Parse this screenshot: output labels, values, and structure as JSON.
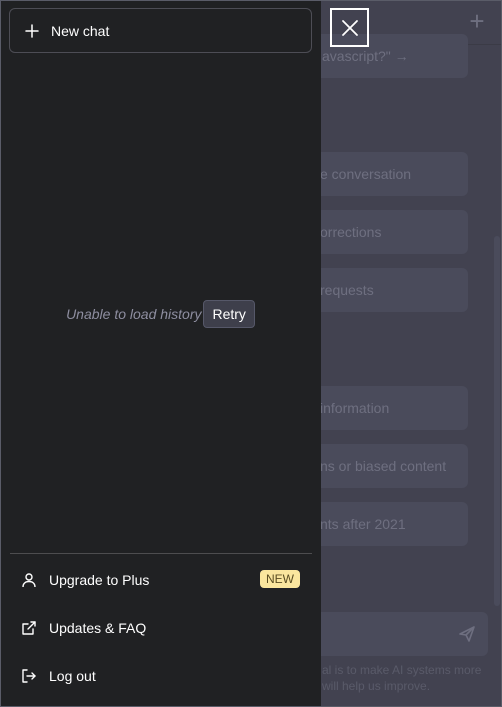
{
  "sidebar": {
    "new_chat_label": "New chat",
    "history_error": "Unable to load history",
    "retry_label": "Retry",
    "menu": [
      {
        "label": "Upgrade to Plus",
        "badge": "NEW",
        "icon": "user-icon"
      },
      {
        "label": "Updates & FAQ",
        "icon": "external-link-icon"
      },
      {
        "label": "Log out",
        "icon": "logout-icon"
      }
    ]
  },
  "main": {
    "cards": [
      {
        "text": "avascript?\" →"
      },
      {
        "text": "e conversation"
      },
      {
        "text": "orrections"
      },
      {
        "text": "requests"
      },
      {
        "text": "information"
      },
      {
        "text": "ns or biased content"
      },
      {
        "text": "nts after 2021"
      }
    ],
    "footer_note_line1": "al is to make AI systems more",
    "footer_note_line2": "will help us improve."
  },
  "colors": {
    "sidebar_bg": "#202123",
    "main_bg": "#4a4b58",
    "card_bg": "#565869",
    "badge_bg": "#fae69e"
  }
}
